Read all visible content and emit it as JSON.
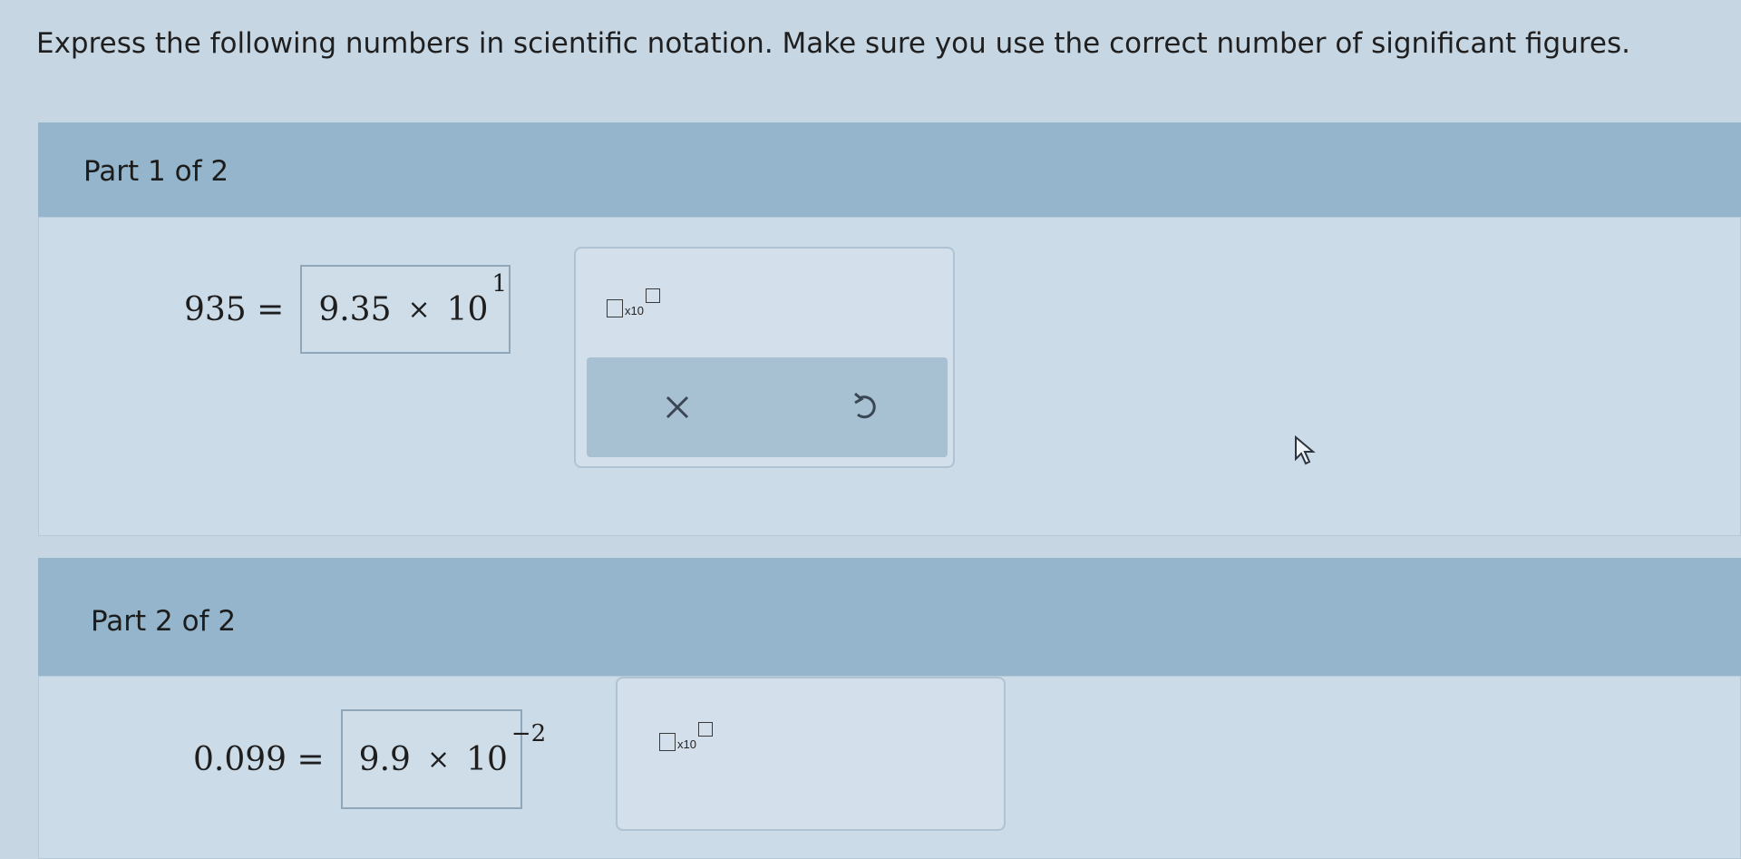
{
  "instructions": "Express the following numbers in scientific notation. Make sure you use the correct number of significant figures.",
  "parts": [
    {
      "title": "Part 1 of 2",
      "question": "935 =",
      "answer": {
        "mantissa": "9.35",
        "times": "×",
        "base": "10",
        "exponent": "1"
      },
      "tool_template": {
        "times_label": "x10"
      },
      "actions": {
        "clear": "clear-icon",
        "undo": "undo-icon"
      }
    },
    {
      "title": "Part 2 of 2",
      "question": "0.099 =",
      "answer": {
        "mantissa": "9.9",
        "times": "×",
        "base": "10",
        "exponent": "−2"
      },
      "tool_template": {
        "times_label": "x10"
      }
    }
  ],
  "colors": {
    "header": "#94b5cb",
    "body": "#ccdbe8",
    "actions": "#a7c0d2"
  }
}
